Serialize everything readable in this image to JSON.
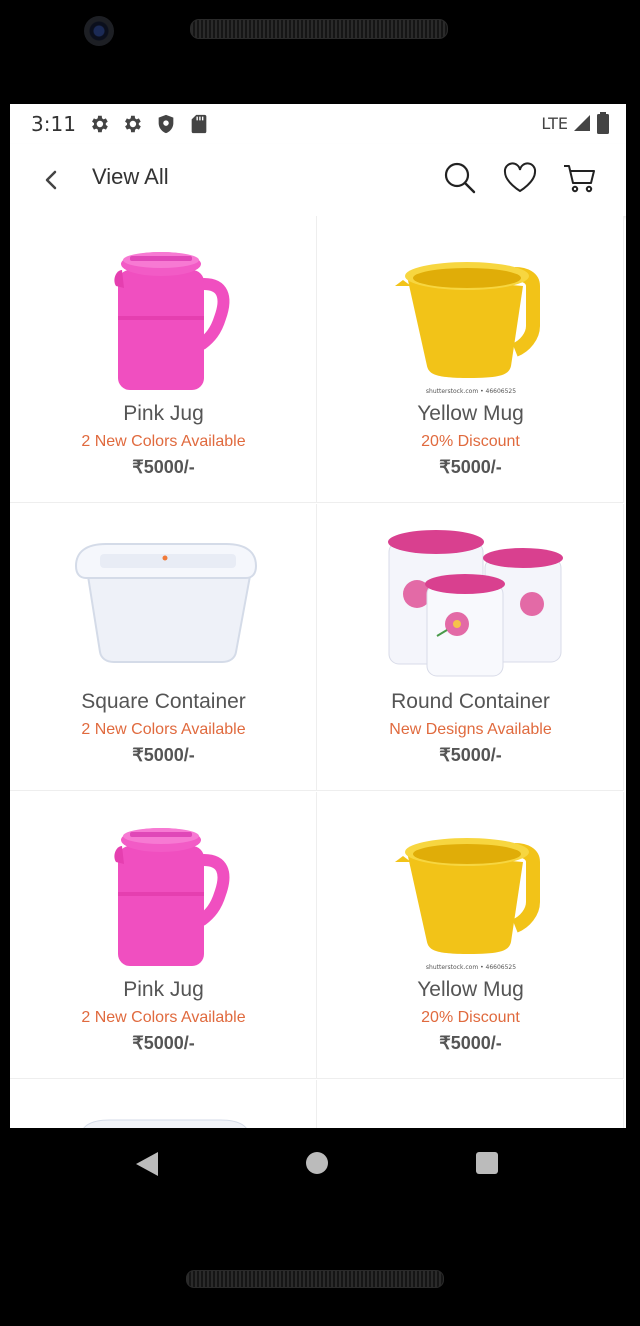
{
  "status_bar": {
    "time": "3:11",
    "network": "LTE",
    "icons": [
      "settings-icon",
      "settings-icon",
      "shield-icon",
      "sd-card-icon",
      "signal-icon",
      "battery-icon"
    ]
  },
  "app_bar": {
    "title": "View All",
    "actions": [
      "search-icon",
      "heart-icon",
      "cart-icon"
    ]
  },
  "products": [
    {
      "name": "Pink Jug",
      "subtitle": "2 New Colors Available",
      "price": "₹5000/-",
      "image": "pink-jug"
    },
    {
      "name": "Yellow Mug",
      "subtitle": "20% Discount",
      "price": "₹5000/-",
      "image": "yellow-mug",
      "watermark": "shutterstock.com • 46606525"
    },
    {
      "name": "Square Container",
      "subtitle": "2 New Colors Available",
      "price": "₹5000/-",
      "image": "square-container"
    },
    {
      "name": "Round Container",
      "subtitle": "New Designs Available",
      "price": "₹5000/-",
      "image": "round-container"
    },
    {
      "name": "Pink Jug",
      "subtitle": "2 New Colors Available",
      "price": "₹5000/-",
      "image": "pink-jug"
    },
    {
      "name": "Yellow Mug",
      "subtitle": "20% Discount",
      "price": "₹5000/-",
      "image": "yellow-mug",
      "watermark": "shutterstock.com • 46606525"
    }
  ],
  "colors": {
    "accent": "#e06a3e",
    "text": "#555555",
    "jug_pink": "#f04fc0",
    "mug_yellow": "#f2c318"
  }
}
